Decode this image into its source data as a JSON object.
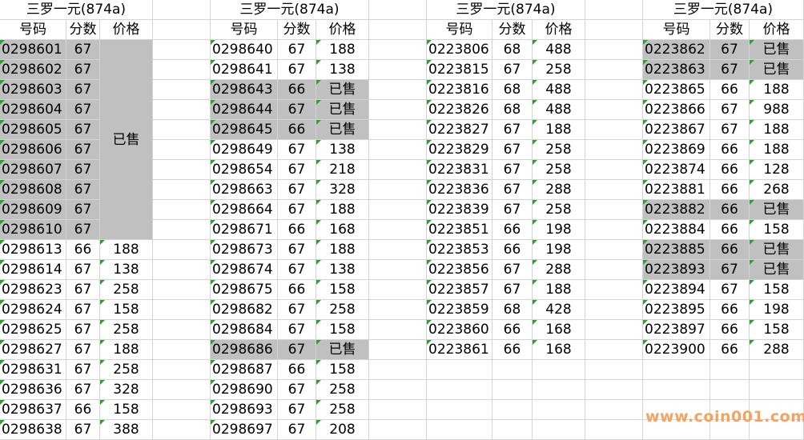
{
  "headers": {
    "code": "号码",
    "score": "分数",
    "price": "价格"
  },
  "watermark": "www.coin001.com",
  "blocks": [
    {
      "title": "三罗一元(874a)",
      "merged_sold": {
        "label": "已售",
        "from": 0,
        "to": 9
      },
      "rows": [
        {
          "code": "0298601",
          "score": "67",
          "price": "",
          "sold": true
        },
        {
          "code": "0298602",
          "score": "67",
          "price": "",
          "sold": true
        },
        {
          "code": "0298603",
          "score": "67",
          "price": "",
          "sold": true
        },
        {
          "code": "0298604",
          "score": "67",
          "price": "",
          "sold": true
        },
        {
          "code": "0298605",
          "score": "67",
          "price": "",
          "sold": true
        },
        {
          "code": "0298606",
          "score": "67",
          "price": "",
          "sold": true
        },
        {
          "code": "0298607",
          "score": "67",
          "price": "",
          "sold": true
        },
        {
          "code": "0298608",
          "score": "67",
          "price": "",
          "sold": true
        },
        {
          "code": "0298609",
          "score": "67",
          "price": "",
          "sold": true
        },
        {
          "code": "0298610",
          "score": "67",
          "price": "",
          "sold": true
        },
        {
          "code": "0298613",
          "score": "66",
          "price": "188",
          "sold": false
        },
        {
          "code": "0298614",
          "score": "67",
          "price": "138",
          "sold": false
        },
        {
          "code": "0298623",
          "score": "67",
          "price": "258",
          "sold": false
        },
        {
          "code": "0298624",
          "score": "67",
          "price": "158",
          "sold": false
        },
        {
          "code": "0298625",
          "score": "67",
          "price": "258",
          "sold": false
        },
        {
          "code": "0298627",
          "score": "67",
          "price": "188",
          "sold": false
        },
        {
          "code": "0298631",
          "score": "67",
          "price": "258",
          "sold": false
        },
        {
          "code": "0298636",
          "score": "67",
          "price": "328",
          "sold": false
        },
        {
          "code": "0298637",
          "score": "66",
          "price": "158",
          "sold": false
        },
        {
          "code": "0298638",
          "score": "67",
          "price": "388",
          "sold": false
        }
      ]
    },
    {
      "title": "三罗一元(874a)",
      "rows": [
        {
          "code": "0298640",
          "score": "67",
          "price": "188",
          "sold": false
        },
        {
          "code": "0298641",
          "score": "67",
          "price": "138",
          "sold": false
        },
        {
          "code": "0298643",
          "score": "66",
          "price": "已售",
          "sold": true
        },
        {
          "code": "0298644",
          "score": "67",
          "price": "已售",
          "sold": true
        },
        {
          "code": "0298645",
          "score": "66",
          "price": "已售",
          "sold": true
        },
        {
          "code": "0298649",
          "score": "67",
          "price": "138",
          "sold": false
        },
        {
          "code": "0298654",
          "score": "67",
          "price": "218",
          "sold": false
        },
        {
          "code": "0298663",
          "score": "67",
          "price": "328",
          "sold": false
        },
        {
          "code": "0298664",
          "score": "67",
          "price": "188",
          "sold": false
        },
        {
          "code": "0298671",
          "score": "66",
          "price": "168",
          "sold": false
        },
        {
          "code": "0298673",
          "score": "67",
          "price": "188",
          "sold": false
        },
        {
          "code": "0298674",
          "score": "67",
          "price": "138",
          "sold": false
        },
        {
          "code": "0298675",
          "score": "66",
          "price": "158",
          "sold": false
        },
        {
          "code": "0298682",
          "score": "67",
          "price": "258",
          "sold": false
        },
        {
          "code": "0298684",
          "score": "67",
          "price": "158",
          "sold": false
        },
        {
          "code": "0298686",
          "score": "67",
          "price": "已售",
          "sold": true
        },
        {
          "code": "0298687",
          "score": "66",
          "price": "158",
          "sold": false
        },
        {
          "code": "0298690",
          "score": "67",
          "price": "258",
          "sold": false
        },
        {
          "code": "0298693",
          "score": "67",
          "price": "258",
          "sold": false
        },
        {
          "code": "0298697",
          "score": "67",
          "price": "208",
          "sold": false
        }
      ]
    },
    {
      "title": "三罗一元(874a)",
      "rows": [
        {
          "code": "0223806",
          "score": "68",
          "price": "488",
          "sold": false
        },
        {
          "code": "0223815",
          "score": "67",
          "price": "258",
          "sold": false
        },
        {
          "code": "0223816",
          "score": "68",
          "price": "488",
          "sold": false
        },
        {
          "code": "0223826",
          "score": "68",
          "price": "488",
          "sold": false
        },
        {
          "code": "0223827",
          "score": "67",
          "price": "188",
          "sold": false
        },
        {
          "code": "0223829",
          "score": "67",
          "price": "258",
          "sold": false
        },
        {
          "code": "0223831",
          "score": "67",
          "price": "258",
          "sold": false
        },
        {
          "code": "0223836",
          "score": "67",
          "price": "288",
          "sold": false
        },
        {
          "code": "0223839",
          "score": "67",
          "price": "258",
          "sold": false
        },
        {
          "code": "0223851",
          "score": "66",
          "price": "198",
          "sold": false
        },
        {
          "code": "0223853",
          "score": "66",
          "price": "198",
          "sold": false
        },
        {
          "code": "0223856",
          "score": "67",
          "price": "288",
          "sold": false
        },
        {
          "code": "0223857",
          "score": "67",
          "price": "188",
          "sold": false
        },
        {
          "code": "0223859",
          "score": "68",
          "price": "428",
          "sold": false
        },
        {
          "code": "0223860",
          "score": "66",
          "price": "168",
          "sold": false
        },
        {
          "code": "0223861",
          "score": "66",
          "price": "168",
          "sold": false
        }
      ]
    },
    {
      "title": "三罗一元(874a)",
      "rows": [
        {
          "code": "0223862",
          "score": "67",
          "price": "已售",
          "sold": true
        },
        {
          "code": "0223863",
          "score": "67",
          "price": "已售",
          "sold": true
        },
        {
          "code": "0223865",
          "score": "66",
          "price": "188",
          "sold": false
        },
        {
          "code": "0223866",
          "score": "67",
          "price": "988",
          "sold": false
        },
        {
          "code": "0223867",
          "score": "67",
          "price": "188",
          "sold": false
        },
        {
          "code": "0223869",
          "score": "66",
          "price": "188",
          "sold": false
        },
        {
          "code": "0223874",
          "score": "66",
          "price": "128",
          "sold": false
        },
        {
          "code": "0223881",
          "score": "66",
          "price": "268",
          "sold": false
        },
        {
          "code": "0223882",
          "score": "66",
          "price": "已售",
          "sold": true
        },
        {
          "code": "0223884",
          "score": "66",
          "price": "158",
          "sold": false
        },
        {
          "code": "0223885",
          "score": "66",
          "price": "已售",
          "sold": true
        },
        {
          "code": "0223893",
          "score": "67",
          "price": "已售",
          "sold": true
        },
        {
          "code": "0223894",
          "score": "67",
          "price": "158",
          "sold": false
        },
        {
          "code": "0223895",
          "score": "66",
          "price": "198",
          "sold": false
        },
        {
          "code": "0223897",
          "score": "66",
          "price": "158",
          "sold": false
        },
        {
          "code": "0223900",
          "score": "66",
          "price": "288",
          "sold": false
        }
      ]
    }
  ]
}
